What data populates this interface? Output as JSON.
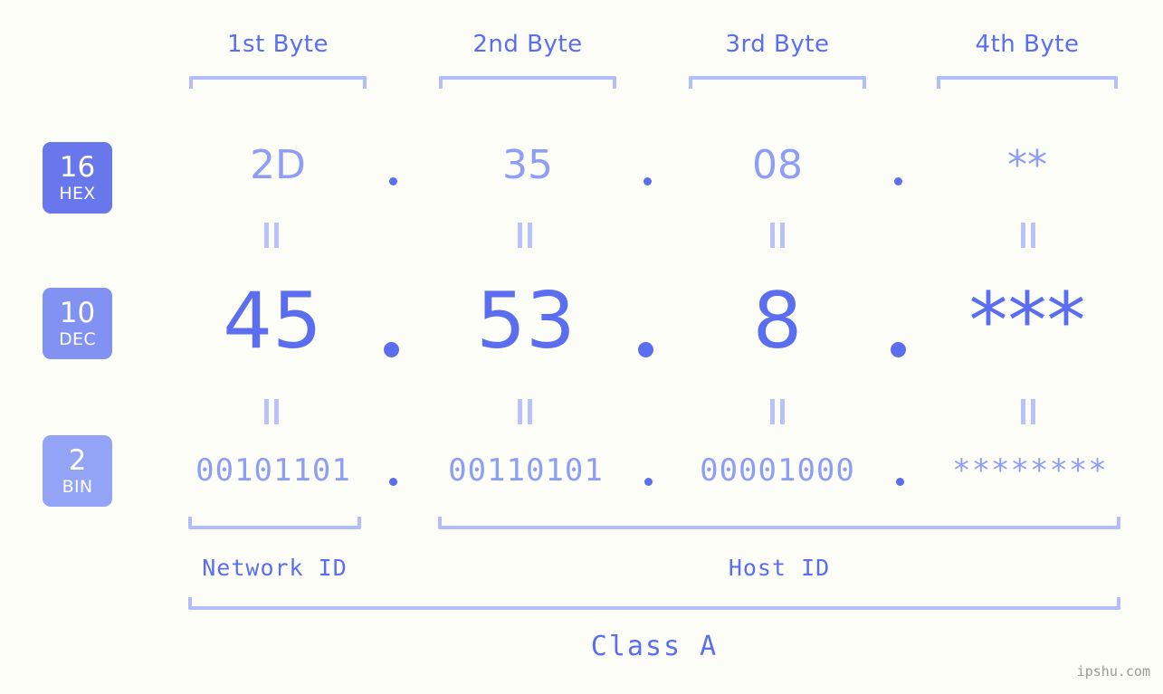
{
  "background_color": "#fcfdf7",
  "accent_color": "#5b6ef0",
  "accent_light_color": "#8e9df5",
  "bracket_color": "#b3bdfb",
  "header": {
    "bytes": [
      {
        "label": "1st Byte"
      },
      {
        "label": "2nd Byte"
      },
      {
        "label": "3rd Byte"
      },
      {
        "label": "4th Byte"
      }
    ]
  },
  "rows": [
    {
      "id": "hex",
      "badge_number": "16",
      "badge_system": "HEX",
      "badge_color": "#6878ec",
      "values": [
        "2D",
        "35",
        "08",
        "**"
      ],
      "separator": "."
    },
    {
      "id": "dec",
      "badge_number": "10",
      "badge_system": "DEC",
      "badge_color": "#8292f2",
      "values": [
        "45",
        "53",
        "8",
        "***"
      ],
      "separator": "."
    },
    {
      "id": "bin",
      "badge_number": "2",
      "badge_system": "BIN",
      "badge_color": "#93a4f7",
      "values": [
        "00101101",
        "00110101",
        "00001000",
        "********"
      ],
      "separator": "."
    }
  ],
  "equals_symbol": "=",
  "footer": {
    "network_id_label": "Network ID",
    "host_id_label": "Host ID",
    "class_label": "Class A"
  },
  "watermark": "ipshu.com"
}
